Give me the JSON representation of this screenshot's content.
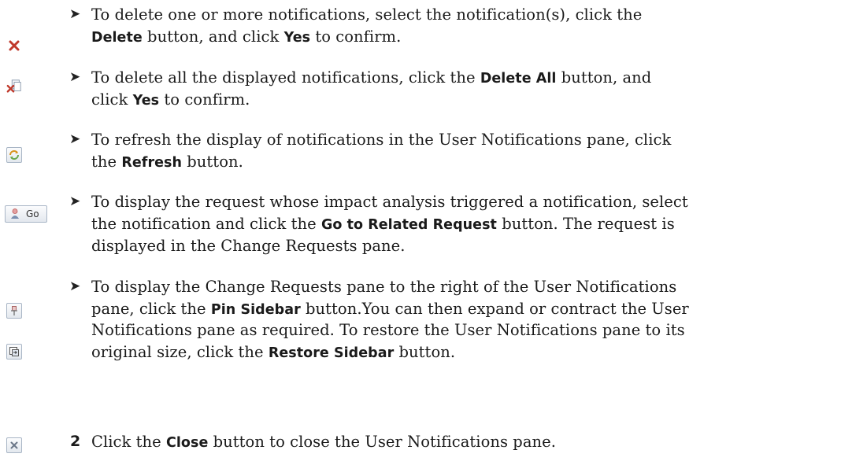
{
  "icons": {
    "delete": "delete-x-icon",
    "delete_all": "delete-all-icon",
    "refresh": "refresh-icon",
    "go_related": "go-to-related-request-icon",
    "go_label": "Go",
    "pin": "pin-sidebar-icon",
    "restore": "restore-sidebar-icon",
    "close": "close-x-icon"
  },
  "items": [
    {
      "lines": [
        [
          "To delete one or more notifications, select the notification(s), click the"
        ],
        [
          {
            "b": "Delete"
          },
          " button, and click ",
          {
            "b": "Yes"
          },
          " to confirm."
        ]
      ]
    },
    {
      "lines": [
        [
          "To delete all the displayed notifications, click the ",
          {
            "b": "Delete All"
          },
          " button, and"
        ],
        [
          "click ",
          {
            "b": "Yes"
          },
          " to confirm."
        ]
      ]
    },
    {
      "lines": [
        [
          "To refresh the display of notifications in the User Notifications pane, click"
        ],
        [
          "the ",
          {
            "b": "Refresh"
          },
          " button."
        ]
      ]
    },
    {
      "lines": [
        [
          "To display the request whose impact analysis triggered a notification, select"
        ],
        [
          "the notification and click the ",
          {
            "b": "Go to Related Request"
          },
          " button. The request is"
        ],
        [
          "displayed in the Change Requests pane."
        ]
      ]
    },
    {
      "lines": [
        [
          "To display the Change Requests pane to the right of the User Notifications"
        ],
        [
          "pane, click the ",
          {
            "b": "Pin Sidebar"
          },
          " button.You can then expand or contract the User"
        ],
        [
          "Notifications pane as required. To restore the User Notifications pane to its"
        ],
        [
          "original size, click the ",
          {
            "b": "Restore Sidebar"
          },
          " button."
        ]
      ]
    }
  ],
  "step": {
    "number": "2",
    "segments": [
      "Click the ",
      {
        "b": "Close"
      },
      " button to close the User Notifications pane."
    ]
  },
  "colors": {
    "delete_red": "#c0392b",
    "icon_border": "#a9b6c6"
  }
}
